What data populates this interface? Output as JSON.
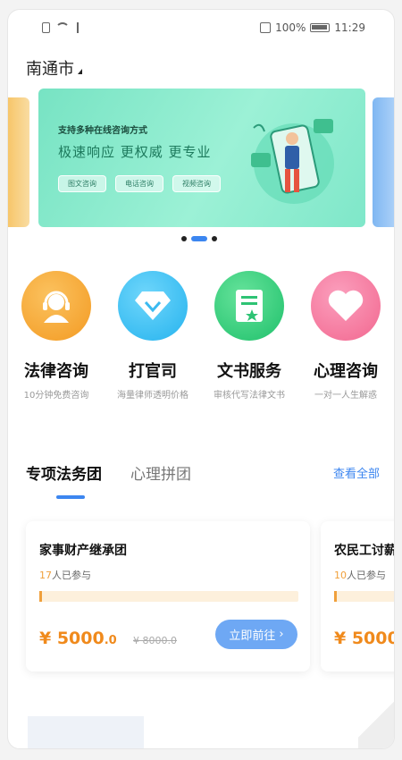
{
  "status_bar": {
    "battery": "100%",
    "time": "11:29"
  },
  "location": {
    "city": "南通市"
  },
  "banner": {
    "headline": "支持多种在线咨询方式",
    "tagline": "极速响应 更权威 更专业",
    "pills": [
      "图文咨询",
      "电话咨询",
      "视频咨询"
    ],
    "colors": {
      "primary": "#77e3c3",
      "accent": "#1d7a5d"
    },
    "carousel_index": 2,
    "carousel_total": 3
  },
  "services": [
    {
      "name": "法律咨询",
      "desc": "10分钟免费咨询",
      "icon": "headset-person-icon",
      "color": "#f7a431"
    },
    {
      "name": "打官司",
      "desc": "海量律师透明价格",
      "icon": "diamond-icon",
      "color": "#35bff2"
    },
    {
      "name": "文书服务",
      "desc": "审核代写法律文书",
      "icon": "document-icon",
      "color": "#2ed17a"
    },
    {
      "name": "心理咨询",
      "desc": "一对一人生解惑",
      "icon": "heart-icon",
      "color": "#f57aa0"
    }
  ],
  "section": {
    "tabs": [
      {
        "label": "专项法务团",
        "active": true
      },
      {
        "label": "心理拼团",
        "active": false
      }
    ],
    "see_all": "查看全部"
  },
  "cards": [
    {
      "title": "家事财产继承团",
      "count": "17",
      "count_suffix": "人已参与",
      "progress": 0.01,
      "price": "¥ 5000",
      "price_decimal": ".0",
      "old_price": "¥ 8000.0",
      "button": "立即前往"
    },
    {
      "title": "农民工讨薪团",
      "count": "10",
      "count_suffix": "人已参与",
      "progress": 0.01,
      "price": "¥ 5000",
      "price_decimal": ".",
      "old_price": "",
      "button": ""
    }
  ]
}
